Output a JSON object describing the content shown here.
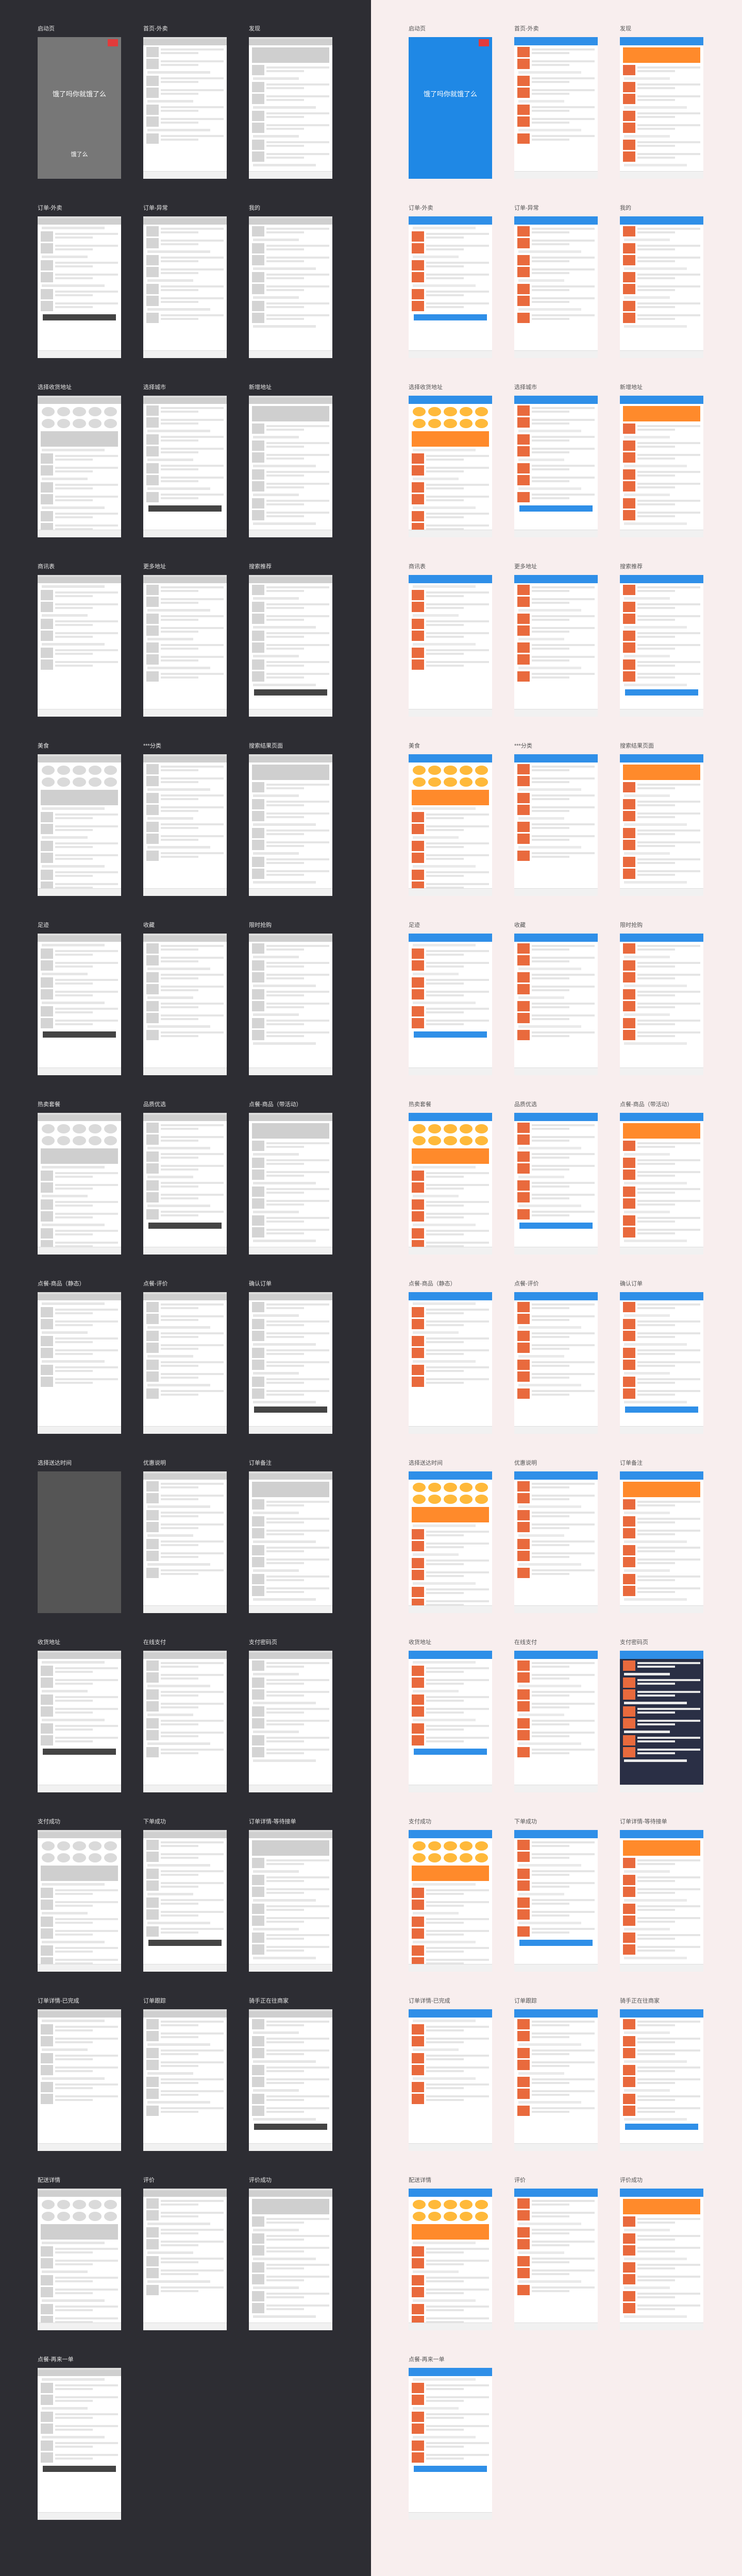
{
  "labels": [
    "启动页",
    "首页-外卖",
    "发现",
    "订单-外卖",
    "订单-异常",
    "我的",
    "选择收货地址",
    "选择城市",
    "新增地址",
    "商讯表",
    "更多地址",
    "搜索推荐",
    "美食",
    "***分类",
    "搜索结果页面",
    "足迹",
    "收藏",
    "限时抢购",
    "热卖套餐",
    "品质优选",
    "点餐-商品（带活动）",
    "点餐-商品（静态）",
    "点餐-评价",
    "确认订单",
    "选择送达时间",
    "优惠说明",
    "订单备注",
    "收货地址",
    "在线支付",
    "支付密码页",
    "支付成功",
    "下单成功",
    "订单详情-等待接单",
    "订单详情-已完成",
    "订单跟踪",
    "骑手正在往商家",
    "配送详情",
    "评价",
    "评价成功",
    "点餐-再来一单"
  ],
  "splash": {
    "left_text": "饿了吗你就饿了么",
    "left_button": "饿了么",
    "right_text": "饿了吗你就饿了么"
  },
  "colors": {
    "left_bg": "#2d2d33",
    "right_bg": "#f8eeee",
    "brand_blue": "#2f8fe8"
  }
}
